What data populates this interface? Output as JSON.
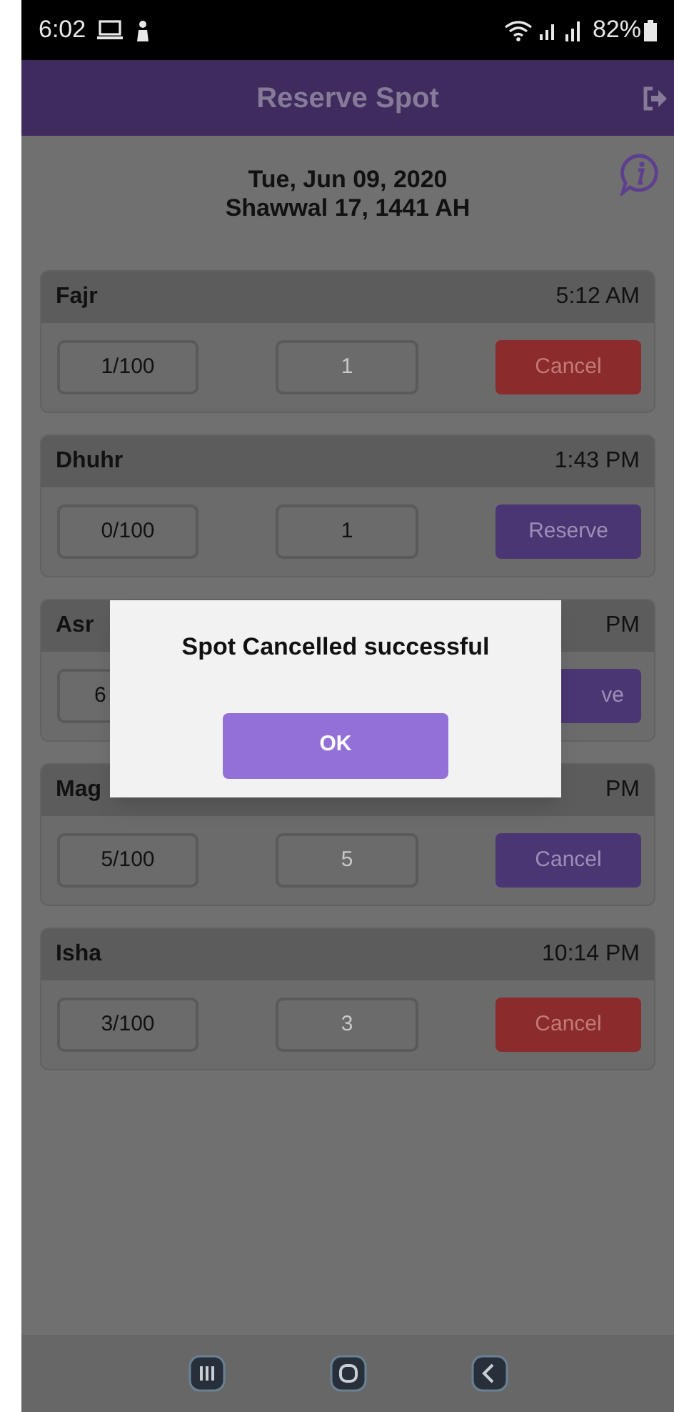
{
  "status_bar": {
    "time": "6:02",
    "battery": "82%"
  },
  "app_bar": {
    "title": "Reserve Spot"
  },
  "date": {
    "gregorian": "Tue, Jun 09, 2020",
    "hijri": "Shawwal 17, 1441 AH"
  },
  "prayers": [
    {
      "name": "Fajr",
      "time": "5:12 AM",
      "count": "1/100",
      "spots": {
        "value": "1",
        "disabled": true
      },
      "action": {
        "kind": "cancel",
        "label": "Cancel"
      },
      "covered": false
    },
    {
      "name": "Dhuhr",
      "time": "1:43 PM",
      "count": "0/100",
      "spots": {
        "value": "1",
        "disabled": false
      },
      "action": {
        "kind": "reserve",
        "label": "Reserve"
      },
      "covered": false
    },
    {
      "name": "Asr",
      "time": "PM",
      "count": "6",
      "action": {
        "kind": "reserve",
        "label": "ve"
      },
      "covered": true
    },
    {
      "name": "Mag",
      "time": "PM",
      "count": "5/100",
      "spots": {
        "value": "5",
        "disabled": true
      },
      "action": {
        "kind": "reserve",
        "label": "Cancel"
      },
      "covered": false
    },
    {
      "name": "Isha",
      "time": "10:14 PM",
      "count": "3/100",
      "spots": {
        "value": "3",
        "disabled": true
      },
      "action": {
        "kind": "cancel",
        "label": "Cancel"
      },
      "covered": false
    }
  ],
  "dialog": {
    "message": "Spot Cancelled successful",
    "button": "OK"
  }
}
